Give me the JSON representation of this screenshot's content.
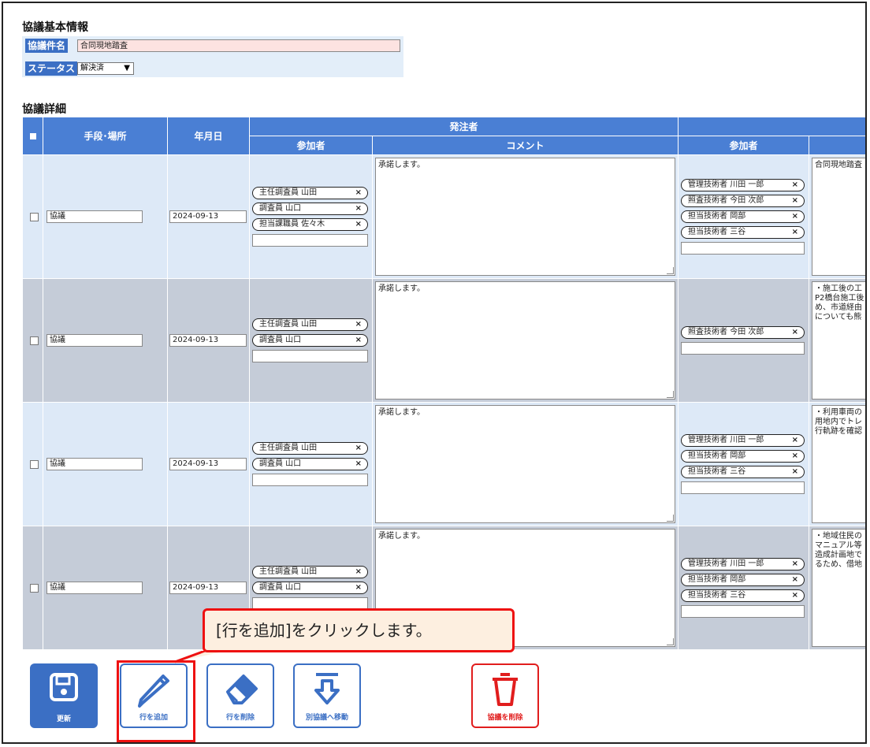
{
  "basic": {
    "title": "協議基本情報",
    "name_label": "協議件名",
    "name_value": "合同現地踏査",
    "status_label": "ステータス",
    "status_value": "解決済"
  },
  "detail": {
    "title": "協議詳細",
    "headers": {
      "method_place": "手段･場所",
      "date": "年月日",
      "orderer": "発注者",
      "participants": "参加者",
      "comment": "コメント",
      "participants2": "参加者"
    },
    "rows": [
      {
        "method": "協議",
        "date": "2024-09-13",
        "orderer_participants": [
          "主任調査員 山田",
          "調査員 山口",
          "担当課職員 佐々木"
        ],
        "comment": "承諾します。",
        "contractor_participants": [
          "管理技術者 川田 一郎",
          "照査技術者 今田 次郎",
          "担当技術者 岡部",
          "担当技術者 三谷"
        ],
        "contractor_comment": "合同現地踏査"
      },
      {
        "method": "協議",
        "date": "2024-09-13",
        "orderer_participants": [
          "主任調査員 山田",
          "調査員 山口"
        ],
        "comment": "承諾します。",
        "contractor_participants": [
          "照査技術者 今田 次郎"
        ],
        "contractor_comment": "・施工後の工\nP2橋台施工後\nめ、市道経由\nについても熊"
      },
      {
        "method": "協議",
        "date": "2024-09-13",
        "orderer_participants": [
          "主任調査員 山田",
          "調査員 山口"
        ],
        "comment": "承諾します。",
        "contractor_participants": [
          "管理技術者 川田 一郎",
          "担当技術者 岡部",
          "担当技術者 三谷"
        ],
        "contractor_comment": "・利用車両の\n用地内でトレ\n行軌跡を確認"
      },
      {
        "method": "協議",
        "date": "2024-09-13",
        "orderer_participants": [
          "主任調査員 山田",
          "調査員 山口"
        ],
        "comment": "承諾します。",
        "contractor_participants": [
          "管理技術者 川田 一郎",
          "担当技術者 岡部",
          "担当技術者 三谷"
        ],
        "contractor_comment": "・地域住民の\nマニュアル等\n造成計画地で\nるため、借地"
      }
    ],
    "remove_mark": "×"
  },
  "callout": "[行を追加]をクリックします。",
  "toolbar": {
    "update": "更新",
    "add_row": "行を追加",
    "delete_row": "行を削除",
    "move": "別協議へ移動",
    "delete_consult": "協議を削除"
  },
  "colors": {
    "header_blue": "#4a7fd4",
    "button_blue": "#3b6fc4",
    "delete_red": "#e11d1d",
    "highlight_red": "#e11111"
  },
  "icons": [
    "save-icon",
    "pencil-icon",
    "eraser-icon",
    "move-down-icon",
    "trash-icon"
  ]
}
